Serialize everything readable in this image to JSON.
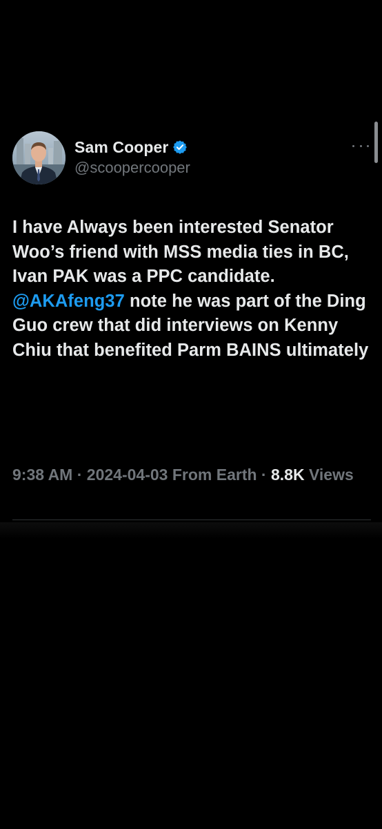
{
  "tweet": {
    "author": {
      "display_name": "Sam Cooper",
      "handle": "@scoopercooper",
      "verified": true,
      "verified_color": "#1d9bf0"
    },
    "text_before_mention": "I have Always been interested Senator Woo’s friend with MSS media ties in BC, Ivan PAK was a PPC candidate. ",
    "mention": "@AKAfeng37",
    "text_after_mention": " note he was part of the Ding Guo crew that did interviews on Kenny Chiu that benefited Parm BAINS ultimately",
    "time": "9:38 AM",
    "separator": " · ",
    "date": "2024-04-03",
    "source": "From Earth",
    "views_count": "8.8K",
    "views_label": "Views",
    "more_icon": "more-horizontal-icon"
  },
  "colors": {
    "background": "#000000",
    "text": "#e7e9ea",
    "secondary": "#71767b",
    "link": "#1d9bf0",
    "divider": "#2f3336"
  }
}
